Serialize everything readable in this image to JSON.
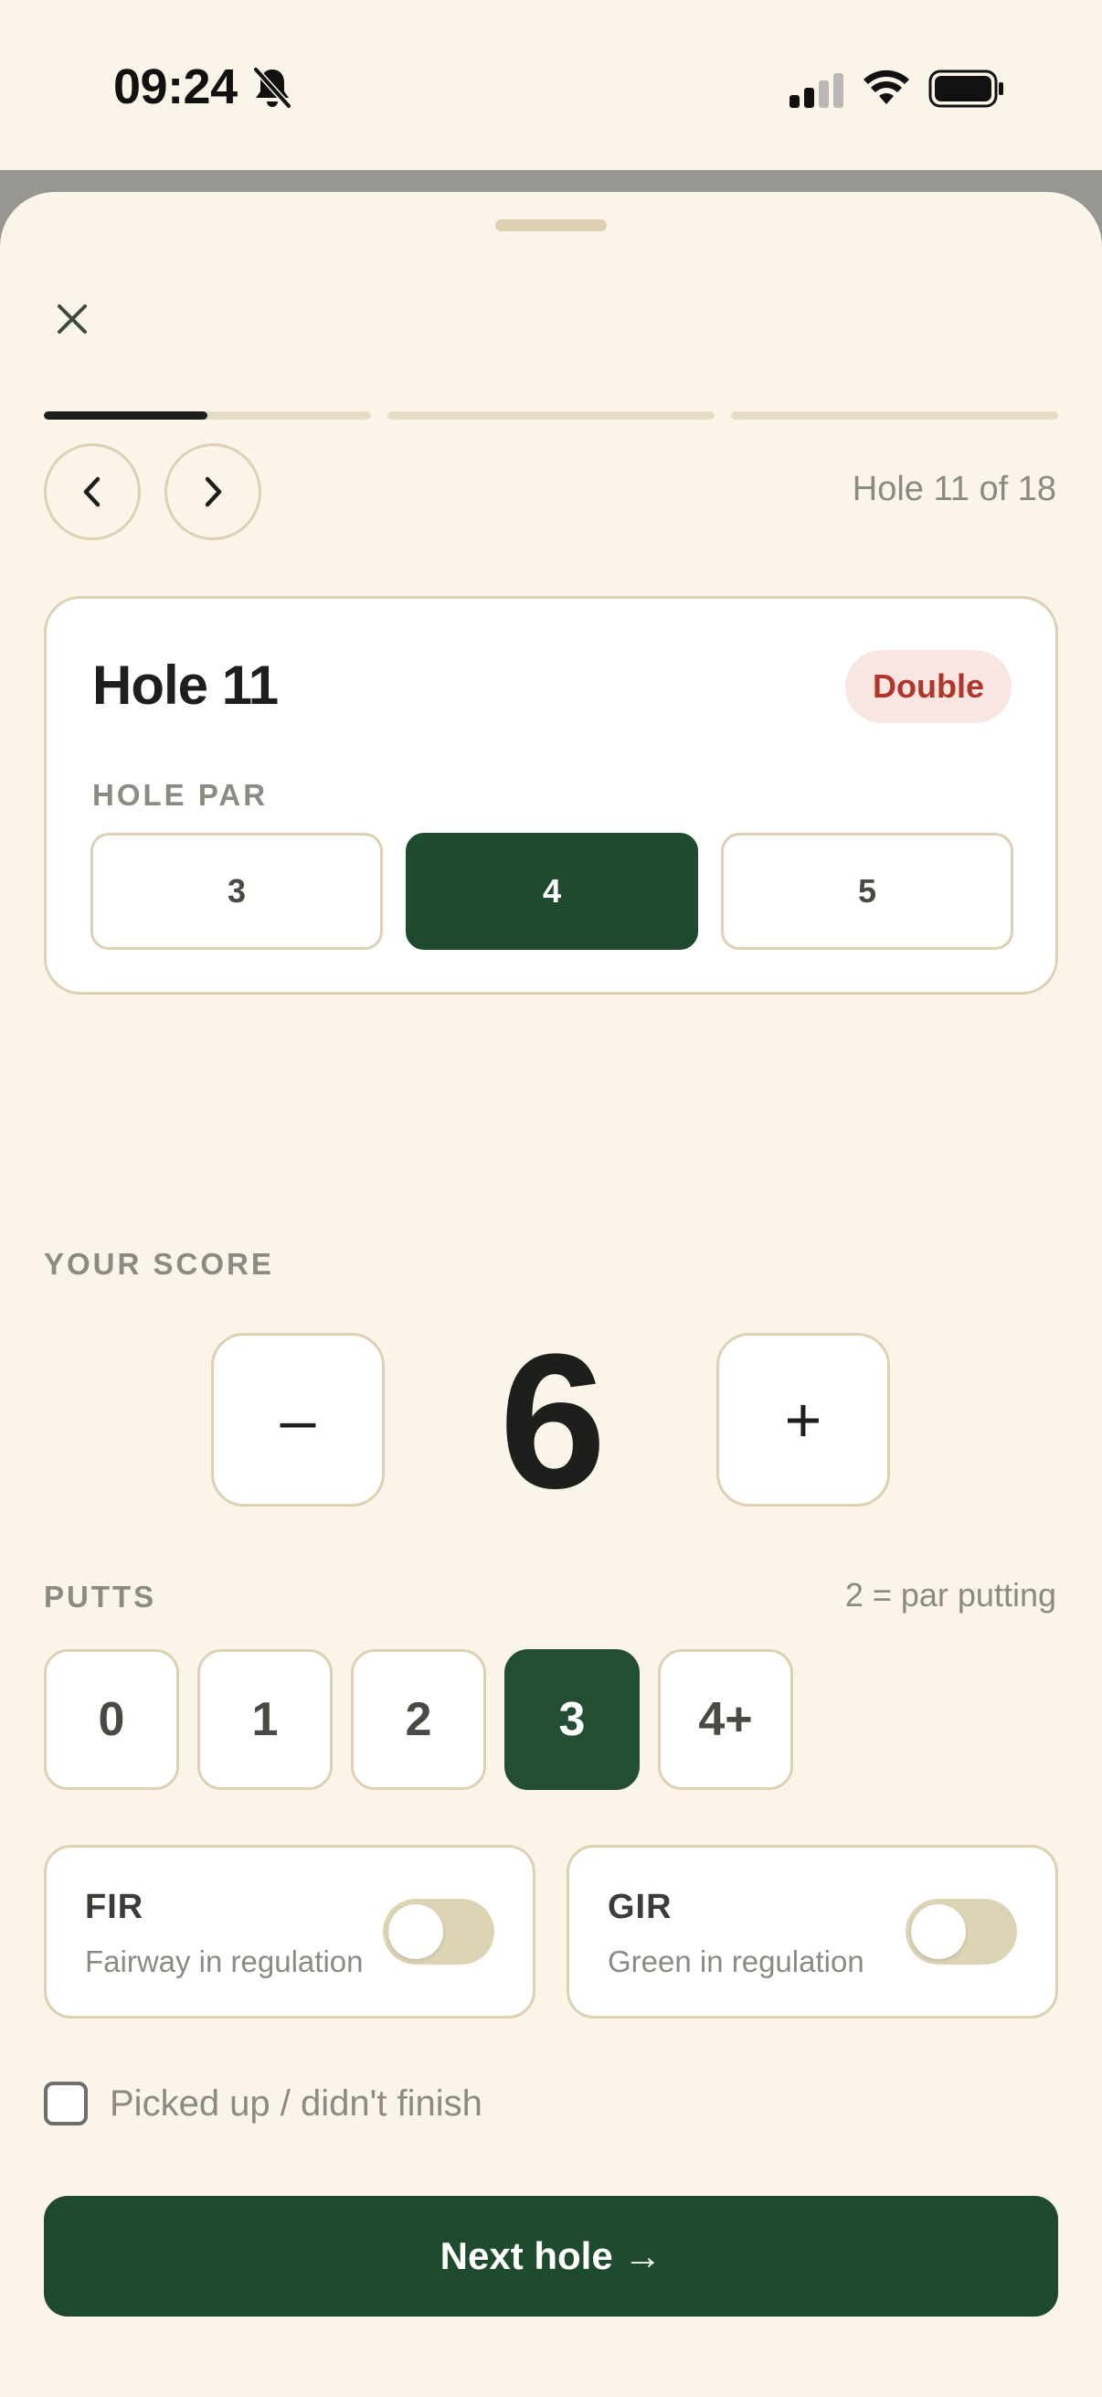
{
  "status_bar": {
    "time": "09:24",
    "icons": [
      "bell-slash-icon",
      "cellular-signal-icon",
      "wifi-icon",
      "battery-icon"
    ]
  },
  "sheet": {
    "close_icon": "close-icon",
    "progress_segments": [
      0.5,
      0,
      0
    ],
    "prev_icon": "chevron-left-icon",
    "next_icon": "chevron-right-icon",
    "hole_counter": "Hole 11 of 18"
  },
  "hole_card": {
    "title": "Hole 11",
    "result_badge": "Double",
    "par_label": "HOLE PAR",
    "par_options": [
      "3",
      "4",
      "5"
    ],
    "selected_par": "4"
  },
  "score": {
    "label": "YOUR SCORE",
    "decrement": "–",
    "value": "6",
    "increment": "+"
  },
  "putts": {
    "label": "PUTTS",
    "hint": "2 = par putting",
    "options": [
      "0",
      "1",
      "2",
      "3",
      "4+"
    ],
    "selected": "3"
  },
  "stats": {
    "fir": {
      "title": "FIR",
      "subtitle": "Fairway in regulation",
      "on": false
    },
    "gir": {
      "title": "GIR",
      "subtitle": "Green in regulation",
      "on": false
    }
  },
  "pickup": {
    "label": "Picked up / didn't finish",
    "checked": false
  },
  "next_button": "Next hole →",
  "colors": {
    "background": "#FBF4E8",
    "primary_green": "#1E4A2E",
    "border": "#DDD0B3",
    "badge_bg": "#F7E6E1",
    "badge_text": "#B3352A",
    "muted_text": "#8C8A82"
  }
}
